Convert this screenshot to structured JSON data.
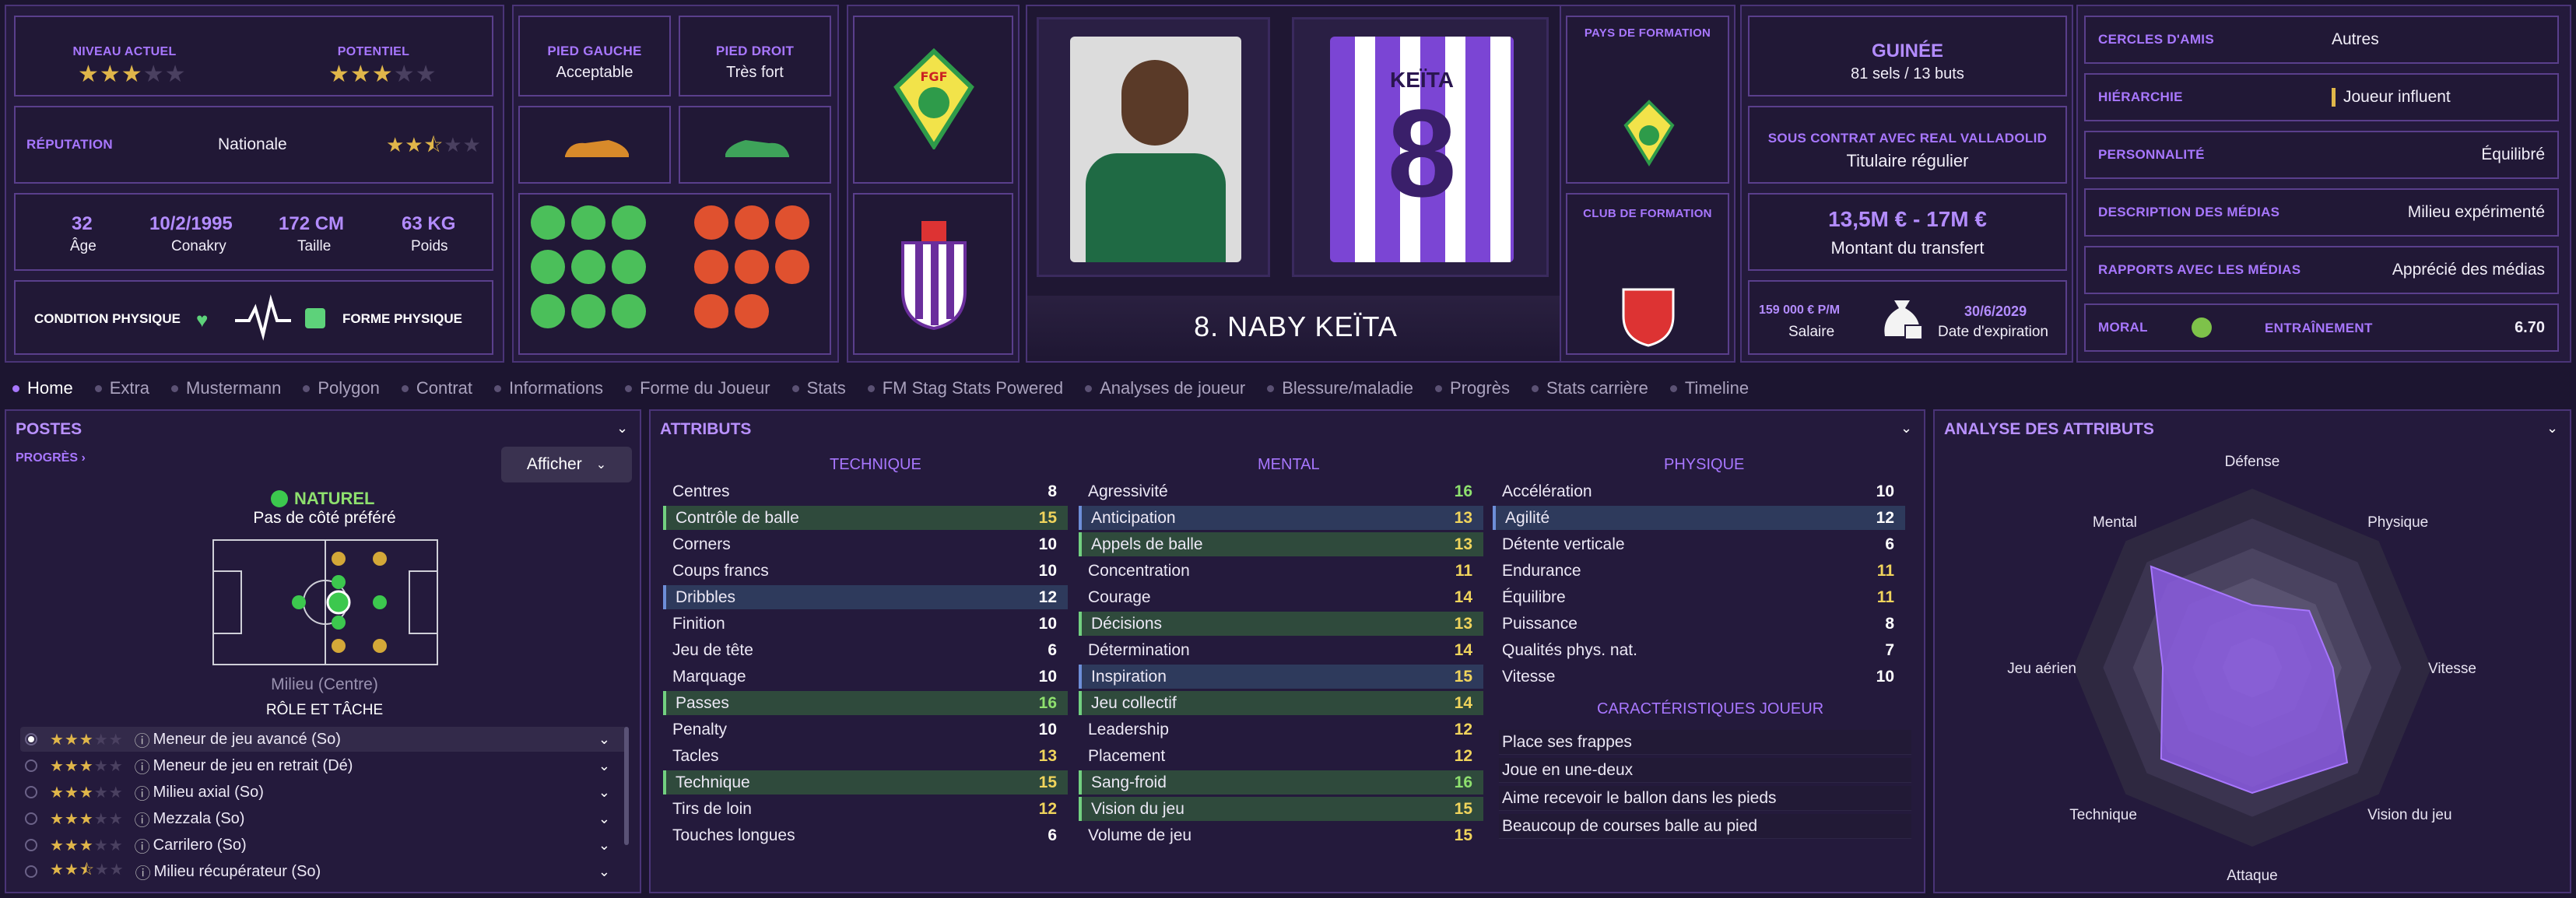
{
  "player": {
    "name": "8. NABY KEÏTA",
    "shirt_name": "KEÏTA",
    "shirt_number": "8"
  },
  "ratings": {
    "current_label": "NIVEAU ACTUEL",
    "potential_label": "POTENTIEL",
    "current_stars": 3,
    "potential_stars": 3
  },
  "reputation": {
    "label": "RÉPUTATION",
    "value": "Nationale",
    "stars": 2.5
  },
  "bio": {
    "age": "32",
    "age_label": "Âge",
    "dob": "10/2/1995",
    "birthplace": "Conakry",
    "height": "172 CM",
    "height_label": "Taille",
    "weight": "63 KG",
    "weight_label": "Poids"
  },
  "condition": {
    "label": "CONDITION PHYSIQUE",
    "form_label": "FORME PHYSIQUE"
  },
  "feet": {
    "left_label": "PIED GAUCHE",
    "left_value": "Acceptable",
    "right_label": "PIED DROIT",
    "right_value": "Très fort"
  },
  "formation": {
    "country_label": "PAYS DE FORMATION",
    "club_label": "CLUB DE FORMATION"
  },
  "nation": {
    "name": "GUINÉE",
    "caps": "81 sels / 13 buts"
  },
  "contract": {
    "label": "SOUS CONTRAT AVEC REAL VALLADOLID",
    "status": "Titulaire régulier"
  },
  "transfer": {
    "value": "13,5M € - 17M €",
    "label": "Montant du transfert"
  },
  "wage": {
    "value": "159 000 € P/M",
    "label": "Salaire",
    "expiry": "30/6/2029",
    "expiry_label": "Date d'expiration"
  },
  "info": [
    {
      "label": "CERCLES D'AMIS",
      "value": "Autres"
    },
    {
      "label": "HIÉRARCHIE",
      "value": "Joueur influent"
    },
    {
      "label": "PERSONNALITÉ",
      "value": "Équilibré"
    },
    {
      "label": "DESCRIPTION DES MÉDIAS",
      "value": "Milieu expérimenté"
    },
    {
      "label": "RAPPORTS AVEC LES MÉDIAS",
      "value": "Apprécié des médias"
    }
  ],
  "morale": {
    "label": "MORAL",
    "training_label": "ENTRAÎNEMENT",
    "training_value": "6.70"
  },
  "tabs": [
    "Home",
    "Extra",
    "Mustermann",
    "Polygon",
    "Contrat",
    "Informations",
    "Forme du Joueur",
    "Stats",
    "FM Stag Stats Powered",
    "Analyses de joueur",
    "Blessure/maladie",
    "Progrès",
    "Stats carrière",
    "Timeline"
  ],
  "positions": {
    "title": "POSTES",
    "progress": "PROGRÈS",
    "show_button": "Afficher",
    "natural": "NATUREL",
    "side": "Pas de côté préféré",
    "position_name": "Milieu (Centre)",
    "role_title": "RÔLE ET TÂCHE",
    "roles": [
      {
        "name": "Meneur de jeu avancé (So)",
        "stars": 3
      },
      {
        "name": "Meneur de jeu en retrait (Dé)",
        "stars": 3
      },
      {
        "name": "Milieu axial (So)",
        "stars": 3
      },
      {
        "name": "Mezzala (So)",
        "stars": 3
      },
      {
        "name": "Carrilero (So)",
        "stars": 3
      },
      {
        "name": "Milieu récupérateur (So)",
        "stars": 2.5
      }
    ]
  },
  "attributes": {
    "title": "ATTRIBUTS",
    "tech_title": "TECHNIQUE",
    "mental_title": "MENTAL",
    "phys_title": "PHYSIQUE",
    "traits_title": "CARACTÉRISTIQUES JOUEUR",
    "technical": [
      [
        "Centres",
        "8",
        ""
      ],
      [
        "Contrôle de balle",
        "15",
        "g"
      ],
      [
        "Corners",
        "10",
        ""
      ],
      [
        "Coups francs",
        "10",
        ""
      ],
      [
        "Dribbles",
        "12",
        "b"
      ],
      [
        "Finition",
        "10",
        ""
      ],
      [
        "Jeu de tête",
        "6",
        ""
      ],
      [
        "Marquage",
        "10",
        ""
      ],
      [
        "Passes",
        "16",
        "g"
      ],
      [
        "Penalty",
        "10",
        ""
      ],
      [
        "Tacles",
        "13",
        ""
      ],
      [
        "Technique",
        "15",
        "g"
      ],
      [
        "Tirs de loin",
        "12",
        ""
      ],
      [
        "Touches longues",
        "6",
        ""
      ]
    ],
    "mental": [
      [
        "Agressivité",
        "16",
        ""
      ],
      [
        "Anticipation",
        "13",
        "b"
      ],
      [
        "Appels de balle",
        "13",
        "g"
      ],
      [
        "Concentration",
        "11",
        ""
      ],
      [
        "Courage",
        "14",
        ""
      ],
      [
        "Décisions",
        "13",
        "g"
      ],
      [
        "Détermination",
        "14",
        ""
      ],
      [
        "Inspiration",
        "15",
        "b"
      ],
      [
        "Jeu collectif",
        "14",
        "g"
      ],
      [
        "Leadership",
        "12",
        ""
      ],
      [
        "Placement",
        "12",
        ""
      ],
      [
        "Sang-froid",
        "16",
        "g"
      ],
      [
        "Vision du jeu",
        "15",
        "g"
      ],
      [
        "Volume de jeu",
        "15",
        ""
      ]
    ],
    "physical": [
      [
        "Accélération",
        "10",
        ""
      ],
      [
        "Agilité",
        "12",
        "b"
      ],
      [
        "Détente verticale",
        "6",
        ""
      ],
      [
        "Endurance",
        "11",
        ""
      ],
      [
        "Équilibre",
        "11",
        ""
      ],
      [
        "Puissance",
        "8",
        ""
      ],
      [
        "Qualités phys. nat.",
        "7",
        ""
      ],
      [
        "Vitesse",
        "10",
        ""
      ]
    ],
    "traits": [
      "Place ses frappes",
      "Joue en une-deux",
      "Aime recevoir le ballon dans les pieds",
      "Beaucoup de courses balle au pied"
    ]
  },
  "analysis": {
    "title": "ANALYSE DES ATTRIBUTS",
    "axes": [
      "Défense",
      "Physique",
      "Vitesse",
      "Vision du jeu",
      "Attaque",
      "Technique",
      "Jeu aérien",
      "Mental"
    ],
    "values": [
      0.35,
      0.45,
      0.45,
      0.75,
      0.7,
      0.72,
      0.5,
      0.8
    ]
  },
  "colors": {
    "accent": "#a877ff",
    "background": "#1c1530",
    "panel": "#241a3c",
    "border": "#5a3f8c",
    "star": "#e0b64a"
  }
}
